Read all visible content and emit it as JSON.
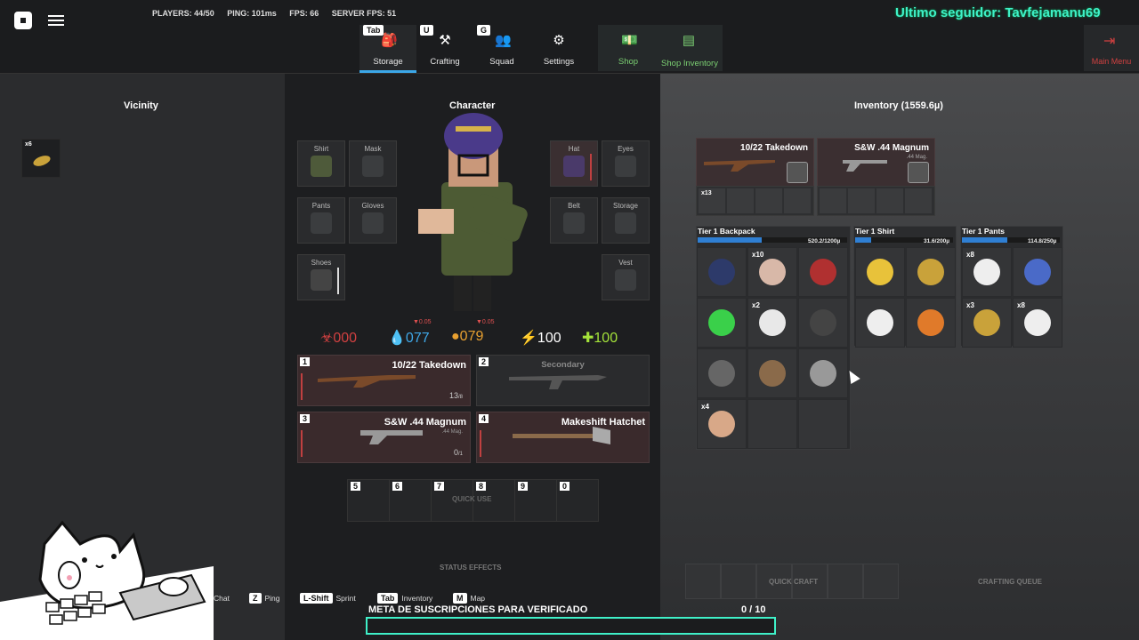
{
  "topbar": {
    "stats": {
      "players": "PLAYERS: 44/50",
      "ping": "PING: 101ms",
      "fps": "FPS: 66",
      "server_fps": "SERVER FPS: 51"
    },
    "overlay_text": "Ultimo seguidor: Tavfejamanu69",
    "tabs": [
      {
        "key": "Tab",
        "label": "Storage",
        "icon": "backpack-icon"
      },
      {
        "key": "U",
        "label": "Crafting",
        "icon": "anvil-icon"
      },
      {
        "key": "G",
        "label": "Squad",
        "icon": "squad-icon"
      },
      {
        "key": "",
        "label": "Settings",
        "icon": "gear-icon"
      }
    ],
    "shop": {
      "label": "Shop",
      "icon": "money-icon"
    },
    "shop_inventory": {
      "label": "Shop Inventory",
      "icon": "cash-register-icon"
    },
    "main_menu": {
      "label": "Main Menu",
      "icon": "exit-icon"
    },
    "accent_color": "#3ba7e8",
    "overlay_color": "#3ff0c8"
  },
  "vicinity": {
    "title": "Vicinity",
    "items": [
      {
        "count": "x6",
        "icon": "ammo-icon"
      }
    ]
  },
  "character": {
    "title": "Character",
    "slots": {
      "shirt": "Shirt",
      "mask": "Mask",
      "pants": "Pants",
      "gloves": "Gloves",
      "shoes": "Shoes",
      "hat": "Hat",
      "eyes": "Eyes",
      "belt": "Belt",
      "storage": "Storage",
      "vest": "Vest"
    },
    "vitals": {
      "radiation": "000",
      "water": "077",
      "water_rate": "▼0.05",
      "food": "079",
      "food_rate": "▼0.05",
      "stamina": "100",
      "health": "100"
    },
    "weapons": [
      {
        "num": "1",
        "name": "10/22 Takedown",
        "sub": "",
        "ammo": "13",
        "ammo_max": "/8"
      },
      {
        "num": "2",
        "name": "Secondary",
        "sub": "",
        "ammo": "",
        "ammo_max": ""
      },
      {
        "num": "3",
        "name": "S&W .44 Magnum",
        "sub": ".44 Mag.",
        "ammo": "0",
        "ammo_max": "/1"
      },
      {
        "num": "4",
        "name": "Makeshift Hatchet",
        "sub": "",
        "ammo": "",
        "ammo_max": ""
      }
    ],
    "quick_use": {
      "label": "QUICK USE",
      "keys": [
        "5",
        "6",
        "7",
        "8",
        "9",
        "0"
      ]
    },
    "status_effects": "STATUS EFFECTS"
  },
  "inventory": {
    "title": "Inventory (1559.6µ)",
    "equipped": [
      {
        "name": "10/22 Takedown",
        "sub": ""
      },
      {
        "name": "S&W .44 Magnum",
        "sub": ".44 Mag."
      }
    ],
    "equipped_row_count": "x13",
    "backpack": {
      "title": "Tier 1 Backpack",
      "capacity": "520.2/1200µ",
      "fill": 0.43,
      "items": [
        {
          "count": "",
          "icon": "helmet-icon"
        },
        {
          "count": "x10",
          "icon": "bandage-icon"
        },
        {
          "count": "",
          "icon": "crowbar-icon"
        },
        {
          "count": "",
          "icon": "glowstick-icon"
        },
        {
          "count": "x2",
          "icon": "cloth-icon"
        },
        {
          "count": "",
          "icon": "rifle-icon"
        },
        {
          "count": "",
          "icon": "pistol-icon"
        },
        {
          "count": "",
          "icon": "compass-icon"
        },
        {
          "count": "",
          "icon": "knife-icon"
        },
        {
          "count": "x4",
          "icon": "leather-icon"
        },
        {
          "count": "",
          "icon": ""
        },
        {
          "count": "",
          "icon": ""
        }
      ]
    },
    "shirt": {
      "title": "Tier 1 Shirt",
      "capacity": "31.6/200µ",
      "fill": 0.16,
      "items": [
        {
          "count": "",
          "icon": "banana-icon"
        },
        {
          "count": "",
          "icon": "bullet-icon"
        },
        {
          "count": "",
          "icon": "tape-icon"
        },
        {
          "count": "",
          "icon": "pill-bottle-icon"
        }
      ]
    },
    "pants": {
      "title": "Tier 1 Pants",
      "capacity": "114.8/250µ",
      "fill": 0.46,
      "items": [
        {
          "count": "x8",
          "icon": "tape-icon"
        },
        {
          "count": "",
          "icon": "can-icon"
        },
        {
          "count": "x3",
          "icon": "bullet-icon"
        },
        {
          "count": "x8",
          "icon": "tape-icon"
        }
      ]
    },
    "quick_craft": "QUICK CRAFT",
    "crafting_queue": "CRAFTING QUEUE"
  },
  "hints": [
    {
      "key": "",
      "label": "Chat"
    },
    {
      "key": "Z",
      "label": "Ping"
    },
    {
      "key": "L-Shift",
      "label": "Sprint"
    },
    {
      "key": "Tab",
      "label": "Inventory"
    },
    {
      "key": "M",
      "label": "Map"
    }
  ],
  "goal": {
    "label": "META DE SUSCRIPCIONES PARA VERIFICADO",
    "count": "0  / 10",
    "progress": 0.0
  }
}
